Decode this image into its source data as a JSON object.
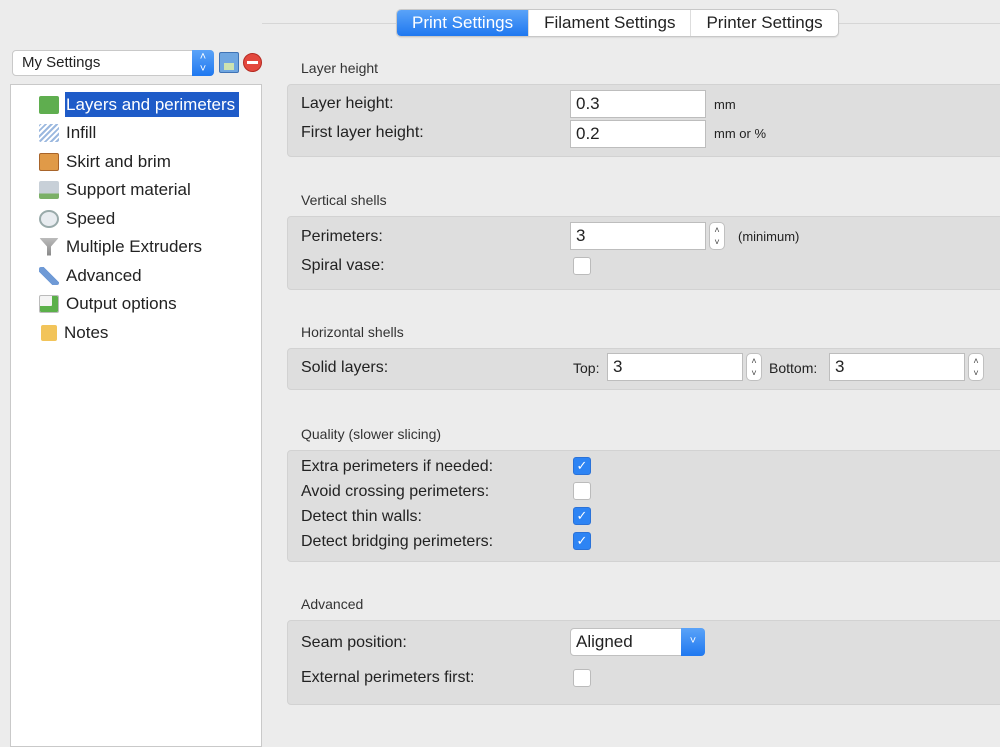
{
  "tabs": [
    {
      "label": "Print Settings",
      "active": true
    },
    {
      "label": "Filament Settings"
    },
    {
      "label": "Printer Settings"
    }
  ],
  "preset": {
    "value": "My Settings"
  },
  "sidebar": {
    "items": [
      {
        "label": "Layers and perimeters",
        "icon": "layers-icon",
        "selected": true
      },
      {
        "label": "Infill",
        "icon": "infill-icon"
      },
      {
        "label": "Skirt and brim",
        "icon": "skirt-icon"
      },
      {
        "label": "Support material",
        "icon": "support-icon"
      },
      {
        "label": "Speed",
        "icon": "clock-icon"
      },
      {
        "label": "Multiple Extruders",
        "icon": "funnel-icon"
      },
      {
        "label": "Advanced",
        "icon": "wrench-icon"
      },
      {
        "label": "Output options",
        "icon": "output-icon"
      },
      {
        "label": "Notes",
        "icon": "note-icon"
      }
    ]
  },
  "groups": {
    "layer_height": {
      "title": "Layer height",
      "layer_height_label": "Layer height:",
      "layer_height": "0.3",
      "layer_height_unit": "mm",
      "first_layer_label": "First layer height:",
      "first_layer": "0.2",
      "first_layer_unit": "mm or %"
    },
    "vertical": {
      "title": "Vertical shells",
      "perimeters_label": "Perimeters:",
      "perimeters": "3",
      "perimeters_unit": "(minimum)",
      "spiral_label": "Spiral vase:",
      "spiral": false
    },
    "horizontal": {
      "title": "Horizontal shells",
      "solid_label": "Solid layers:",
      "top_label": "Top:",
      "top": "3",
      "bottom_label": "Bottom:",
      "bottom": "3"
    },
    "quality": {
      "title": "Quality (slower slicing)",
      "items": [
        {
          "label": "Extra perimeters if needed:",
          "checked": true
        },
        {
          "label": "Avoid crossing perimeters:",
          "checked": false
        },
        {
          "label": "Detect thin walls:",
          "checked": true
        },
        {
          "label": "Detect bridging perimeters:",
          "checked": true
        }
      ]
    },
    "advanced": {
      "title": "Advanced",
      "seam_label": "Seam position:",
      "seam": "Aligned",
      "ext_first_label": "External perimeters first:",
      "ext_first": false
    }
  },
  "colors": {
    "accent": "#1f78f0",
    "selection": "#1e5bc8"
  }
}
